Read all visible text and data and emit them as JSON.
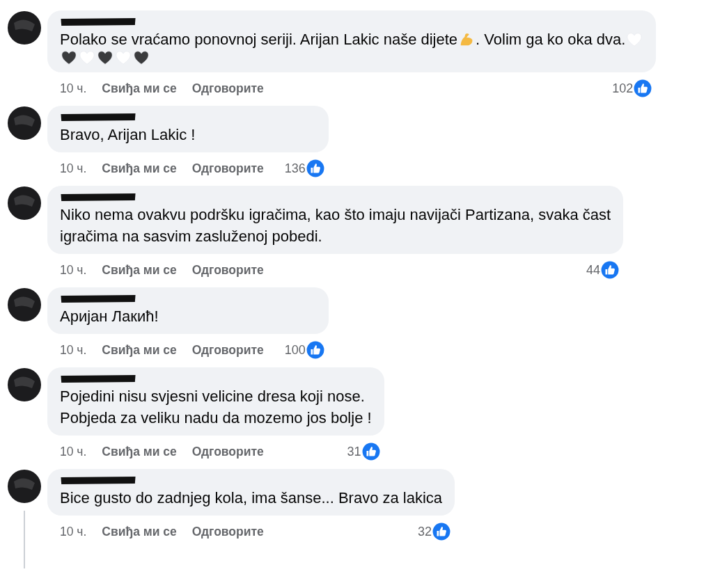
{
  "comments": [
    {
      "lines": [
        [
          {
            "kind": "text",
            "text": "Polako se vraćamo ponovnoj seriji. Arijan Lakic naše dijete "
          },
          {
            "kind": "flexed-arm"
          },
          {
            "kind": "text",
            "text": ". Volim ga ko oka dva. "
          },
          {
            "kind": "heart",
            "color": "#ffffff"
          }
        ],
        [
          {
            "kind": "heart",
            "color": "#3a3b3d"
          },
          {
            "kind": "heart",
            "color": "#ffffff"
          },
          {
            "kind": "heart",
            "color": "#3a3b3d"
          },
          {
            "kind": "heart",
            "color": "#ffffff"
          },
          {
            "kind": "heart",
            "color": "#3a3b3d"
          }
        ]
      ],
      "time": "10 ч.",
      "like": "Свиђа ми се",
      "reply": "Одговорите",
      "likes": "102",
      "thread": false
    },
    {
      "lines": [
        [
          {
            "kind": "text",
            "text": "Bravo, Arijan Lakic !"
          }
        ]
      ],
      "time": "10 ч.",
      "like": "Свиђа ми се",
      "reply": "Одговорите",
      "likes": "136",
      "thread": false
    },
    {
      "lines": [
        [
          {
            "kind": "text",
            "text": "Niko nema ovakvu podršku igračima, kao što imaju navijači Partizana, svaka čast"
          }
        ],
        [
          {
            "kind": "text",
            "text": "igračima na sasvim zasluženoj pobedi."
          }
        ]
      ],
      "time": "10 ч.",
      "like": "Свиђа ми се",
      "reply": "Одговорите",
      "likes": "44",
      "thread": false
    },
    {
      "lines": [
        [
          {
            "kind": "text",
            "text": "Аријан Лакић!"
          }
        ]
      ],
      "time": "10 ч.",
      "like": "Свиђа ми се",
      "reply": "Одговорите",
      "likes": "100",
      "thread": false
    },
    {
      "lines": [
        [
          {
            "kind": "text",
            "text": "Pojedini nisu svjesni velicine dresa koji nose."
          }
        ],
        [
          {
            "kind": "text",
            "text": "Pobjeda za veliku nadu da mozemo jos bolje !"
          }
        ]
      ],
      "time": "10 ч.",
      "like": "Свиђа ми се",
      "reply": "Одговорите",
      "likes": "31",
      "thread": false
    },
    {
      "lines": [
        [
          {
            "kind": "text",
            "text": "Bice gusto do zadnjeg kola, ima šanse... Bravo za lakica"
          }
        ]
      ],
      "time": "10 ч.",
      "like": "Свиђа ми се",
      "reply": "Одговорите",
      "likes": "32",
      "thread": true
    }
  ]
}
